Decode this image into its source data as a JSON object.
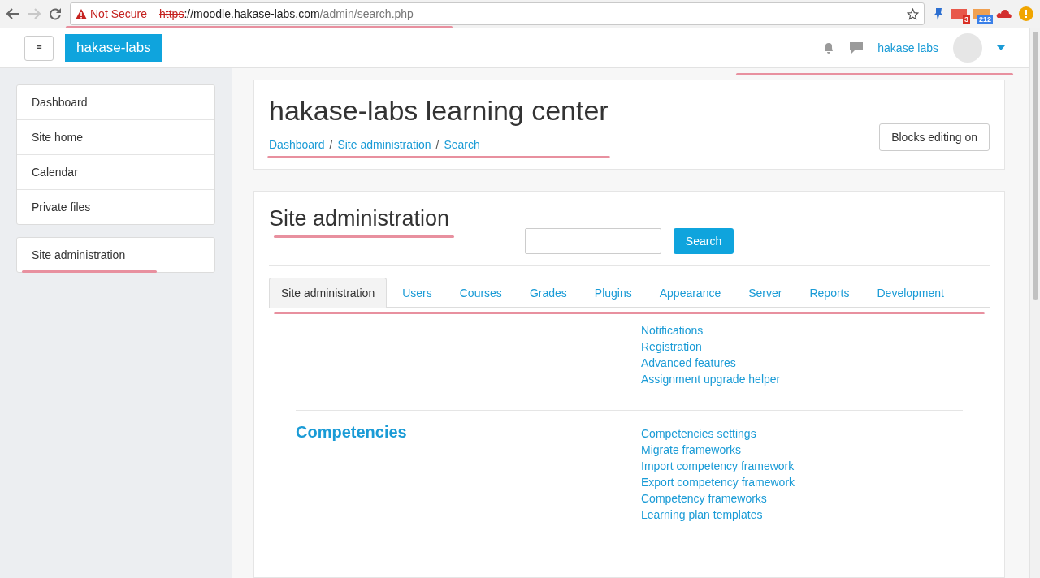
{
  "browser": {
    "security": "Not Secure",
    "url_scheme": "https",
    "url_host": "://moodle.hakase-labs.com",
    "url_path": "/admin/search.php",
    "badges": [
      "3",
      "212"
    ]
  },
  "navbar": {
    "menu_button": "≡",
    "brand": "hakase-labs",
    "user": "hakase labs"
  },
  "sidebar": {
    "groups": [
      [
        "Dashboard",
        "Site home",
        "Calendar",
        "Private files"
      ],
      [
        "Site administration"
      ]
    ]
  },
  "header": {
    "title": "hakase-labs learning center",
    "breadcrumbs": [
      "Dashboard",
      "Site administration",
      "Search"
    ],
    "separator": "/",
    "button": "Blocks editing on"
  },
  "admin": {
    "title": "Site administration",
    "search_button": "Search",
    "tabs": [
      {
        "label": "Site administration",
        "selected": true
      },
      {
        "label": "Users",
        "selected": false
      },
      {
        "label": "Courses",
        "selected": false
      },
      {
        "label": "Grades",
        "selected": false
      },
      {
        "label": "Plugins",
        "selected": false
      },
      {
        "label": "Appearance",
        "selected": false
      },
      {
        "label": "Server",
        "selected": false
      },
      {
        "label": "Reports",
        "selected": false
      },
      {
        "label": "Development",
        "selected": false
      }
    ],
    "sections": [
      {
        "links": [
          "Notifications",
          "Registration",
          "Advanced features",
          "Assignment upgrade helper"
        ]
      },
      {
        "heading": "Competencies",
        "links": [
          "Competencies settings",
          "Migrate frameworks",
          "Import competency framework",
          "Export competency framework",
          "Competency frameworks",
          "Learning plan templates"
        ]
      }
    ]
  }
}
